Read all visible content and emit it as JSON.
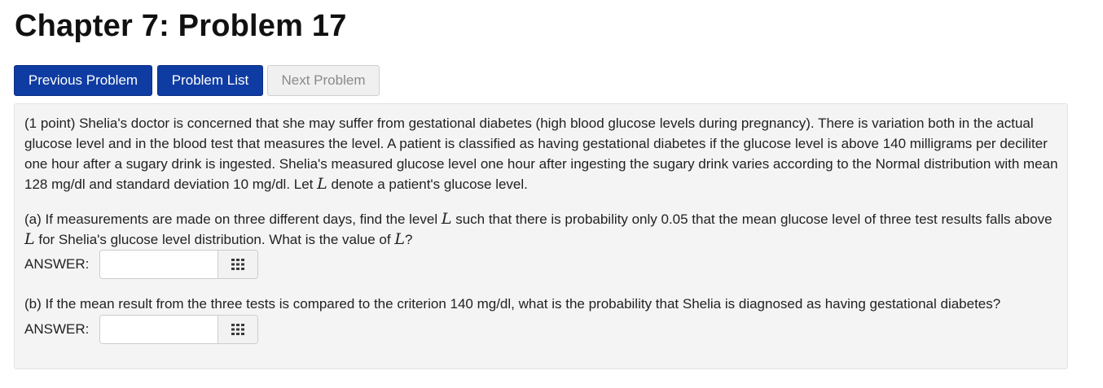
{
  "page": {
    "title": "Chapter 7: Problem 17"
  },
  "nav": {
    "previous_label": "Previous Problem",
    "list_label": "Problem List",
    "next_label": "Next Problem"
  },
  "problem": {
    "intro": {
      "before_var": "(1 point) Shelia's doctor is concerned that she may suffer from gestational diabetes (high blood glucose levels during pregnancy). There is variation both in the actual glucose level and in the blood test that measures the level. A patient is classified as having gestational diabetes if the glucose level is above 140 milligrams per deciliter one hour after a sugary drink is ingested. Shelia's measured glucose level one hour after ingesting the sugary drink varies according to the Normal distribution with mean 128 mg/dl and standard deviation 10 mg/dl. Let ",
      "var": "L",
      "after_var": " denote a patient's glucose level."
    },
    "part_a": {
      "text_1": "(a) If measurements are made on three different days, find the level ",
      "var_1": "L",
      "text_2": " such that there is probability only 0.05 that the mean glucose level of three test results falls above ",
      "var_2": "L",
      "text_3": " for Shelia's glucose level distribution. What is the value of ",
      "var_3": "L",
      "text_4": "?",
      "answer_label": "ANSWER:",
      "answer_value": ""
    },
    "part_b": {
      "text": "(b) If the mean result from the three tests is compared to the criterion 140 mg/dl, what is the probability that Shelia is diagnosed as having gestational diabetes?",
      "answer_label": "ANSWER:",
      "answer_value": ""
    }
  },
  "icons": {
    "equation_editor": "grid-keypad-icon"
  },
  "colors": {
    "primary_button": "#0f3ca3",
    "disabled_button_bg": "#f0f0f0",
    "disabled_button_text": "#8a8a8a",
    "problem_bg": "#f4f4f4"
  }
}
